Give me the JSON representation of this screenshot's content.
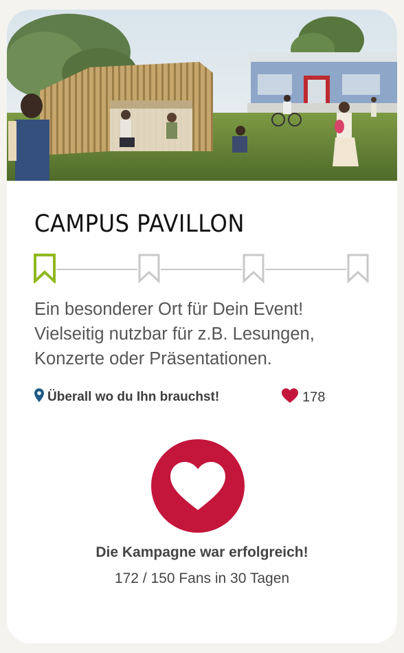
{
  "project": {
    "title": "CAMPUS PAVILLON",
    "description_lines": [
      "Ein besonderer Ort für Dein Event!",
      "Vielseitig nutzbar für z.B. Lesungen,",
      "Konzerte oder Präsentationen."
    ],
    "location": "Überall wo du Ihn brauchst!",
    "likes": "178",
    "stages": {
      "total": 4,
      "completed": 1
    }
  },
  "campaign": {
    "status": "Die Kampagne war erfolgreich!",
    "fans_text": "172 / 150 Fans in 30 Tagen"
  },
  "icons": {
    "stage": "bookmark-icon",
    "location": "map-pin-icon",
    "likes": "heart-icon",
    "campaign": "heart-icon"
  },
  "colors": {
    "stage_active": "#8fb81e",
    "stage_inactive": "#c8c8c8",
    "heart": "#c4153b",
    "pin": "#1f5b86"
  }
}
